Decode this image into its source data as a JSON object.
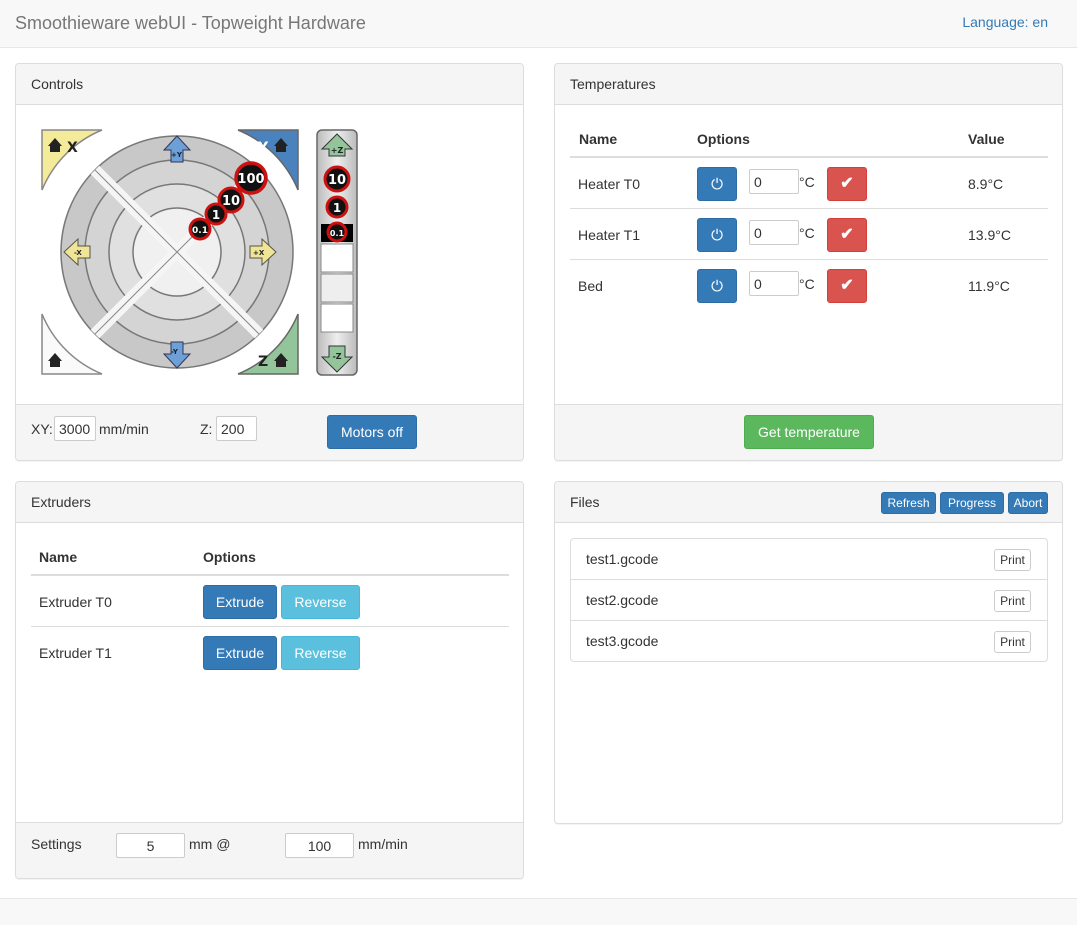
{
  "app": {
    "title": "Smoothieware webUI - Topweight Hardware",
    "language_label": "Language: en"
  },
  "controls": {
    "title": "Controls",
    "jog_labels": {
      "home_x": "X",
      "home_y": "Y",
      "home_z": "Z",
      "plus_y": "+Y",
      "minus_y": "-Y",
      "plus_x": "+X",
      "minus_x": "-X",
      "plus_z": "+Z",
      "minus_z": "-Z",
      "step_100": "100",
      "step_10": "10",
      "step_1": "1",
      "step_01": "0.1",
      "z_step_10": "10",
      "z_step_1": "1",
      "z_step_01": "0.1"
    },
    "xy_label": "XY:",
    "xy_value": "3000",
    "xy_unit": "mm/min",
    "z_label": "Z:",
    "z_value": "200",
    "motors_off_label": "Motors off"
  },
  "temperatures": {
    "title": "Temperatures",
    "columns": [
      "Name",
      "Options",
      "Value"
    ],
    "rows": [
      {
        "name": "Heater T0",
        "setpoint": "0",
        "unit": "°C",
        "value": "8.9°C"
      },
      {
        "name": "Heater T1",
        "setpoint": "0",
        "unit": "°C",
        "value": "13.9°C"
      },
      {
        "name": "Bed",
        "setpoint": "0",
        "unit": "°C",
        "value": "11.9°C"
      }
    ],
    "get_temperature_label": "Get temperature"
  },
  "extruders": {
    "title": "Extruders",
    "columns": [
      "Name",
      "Options"
    ],
    "rows": [
      {
        "name": "Extruder T0",
        "extrude_label": "Extrude",
        "reverse_label": "Reverse"
      },
      {
        "name": "Extruder T1",
        "extrude_label": "Extrude",
        "reverse_label": "Reverse"
      }
    ],
    "settings_label": "Settings",
    "length_value": "5",
    "length_unit": "mm @",
    "speed_value": "100",
    "speed_unit": "mm/min"
  },
  "files": {
    "title": "Files",
    "refresh_label": "Refresh",
    "progress_label": "Progress",
    "abort_label": "Abort",
    "items": [
      {
        "name": "test1.gcode",
        "print_label": "Print"
      },
      {
        "name": "test2.gcode",
        "print_label": "Print"
      },
      {
        "name": "test3.gcode",
        "print_label": "Print"
      }
    ]
  },
  "colors": {
    "primary": "#337ab7",
    "success": "#5cb85c",
    "danger": "#d9534f",
    "info": "#5bc0de",
    "home_x": "#f3eb9a",
    "home_y": "#4a82bd",
    "home_z": "#93c49a",
    "step_ring": "#cc1111"
  }
}
